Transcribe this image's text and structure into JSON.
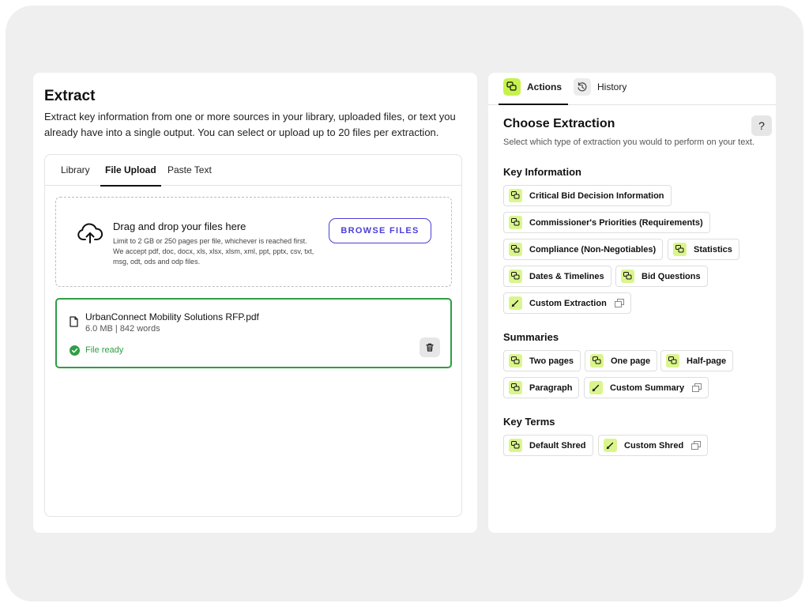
{
  "extract": {
    "title": "Extract",
    "description": "Extract key information from one or more sources in your library, uploaded files, or text you already have into a single output. You can select or upload up to 20 files per extraction.",
    "tabs": [
      {
        "label": "Library"
      },
      {
        "label": "File Upload",
        "active": true
      },
      {
        "label": "Paste Text"
      }
    ],
    "dropzone": {
      "title": "Drag and drop your files here",
      "description": "Limit to 2 GB or 250 pages per file, whichever is reached first. We accept pdf, doc, docx, xls, xlsx, xlsm, xml, ppt, pptx, csv, txt, msg, odt, ods and odp files.",
      "browse_label": "BROWSE FILES"
    },
    "file": {
      "name": "UrbanConnect Mobility Solutions RFP.pdf",
      "meta": "6.0 MB | 842 words",
      "status": "File ready"
    }
  },
  "panel": {
    "tabs": [
      {
        "label": "Actions",
        "active": true
      },
      {
        "label": "History"
      }
    ],
    "title": "Choose Extraction",
    "help_label": "?",
    "subtitle": "Select which type of extraction you would to perform on your text.",
    "sections": {
      "key_information": {
        "title": "Key Information",
        "items": [
          "Critical Bid Decision Information",
          "Commissioner's Priorities (Requirements)",
          "Compliance (Non-Negotiables)",
          "Statistics",
          "Dates & Timelines",
          "Bid Questions",
          "Custom Extraction"
        ]
      },
      "summaries": {
        "title": "Summaries",
        "items": [
          "Two pages",
          "One page",
          "Half-page",
          "Paragraph",
          "Custom Summary"
        ]
      },
      "key_terms": {
        "title": "Key Terms",
        "items": [
          "Default Shred",
          "Custom Shred"
        ]
      }
    }
  },
  "colors": {
    "accent_primary": "#4b3fd6",
    "success_green": "#2f9e44",
    "chip_icon_bg": "#dbf58d",
    "tab_icon_bg": "#c6f24e"
  },
  "icons": {
    "upload": "cloud-upload-icon",
    "file": "document-icon",
    "ready": "check-circle-icon",
    "delete": "trash-icon",
    "chip_default": "chat-bubbles-icon",
    "chip_custom": "pencil-icon",
    "chip_expand": "copy-icon",
    "history": "history-icon"
  }
}
